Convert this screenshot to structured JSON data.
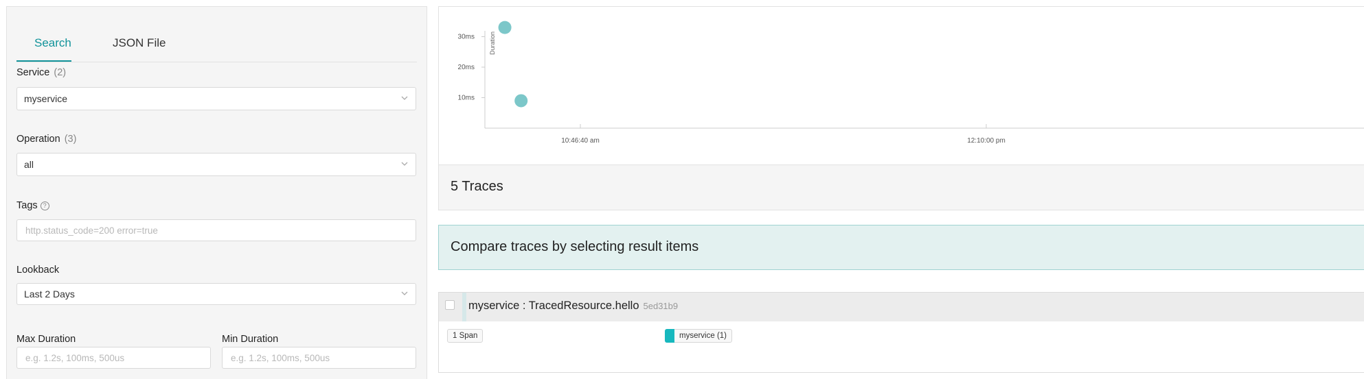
{
  "search_panel": {
    "tabs": [
      {
        "label": "Search",
        "active": true
      },
      {
        "label": "JSON File",
        "active": false
      }
    ],
    "service": {
      "label": "Service",
      "count": "(2)",
      "value": "myservice"
    },
    "operation": {
      "label": "Operation",
      "count": "(3)",
      "value": "all"
    },
    "tags": {
      "label": "Tags",
      "help_icon": "question-circle-icon",
      "placeholder": "http.status_code=200 error=true"
    },
    "lookback": {
      "label": "Lookback",
      "value": "Last 2 Days"
    },
    "max_duration": {
      "label": "Max Duration",
      "placeholder": "e.g. 1.2s, 100ms, 500us"
    },
    "min_duration": {
      "label": "Min Duration",
      "placeholder": "e.g. 1.2s, 100ms, 500us"
    }
  },
  "results": {
    "traces_title": "5 Traces",
    "compare_message": "Compare traces by selecting result items",
    "trace": {
      "title": "myservice : TracedResource.hello",
      "trace_id": "5ed31b9",
      "span_count": "1 Span",
      "service_tag": "myservice (1)",
      "service_color": "#17b8be"
    }
  },
  "colors": {
    "accent": "#11939a",
    "point": "#7cc7c9",
    "compare_bg": "#e3f1f0"
  },
  "chart_data": {
    "type": "scatter",
    "ylabel": "Duration",
    "yticks": [
      "10ms",
      "20ms",
      "30ms"
    ],
    "xticks": [
      "10:46:40 am",
      "12:10:00 pm"
    ],
    "points": [
      {
        "t": "10:31:10 am",
        "duration_ms": 33
      },
      {
        "t": "10:34:30 am",
        "duration_ms": 9
      }
    ]
  }
}
